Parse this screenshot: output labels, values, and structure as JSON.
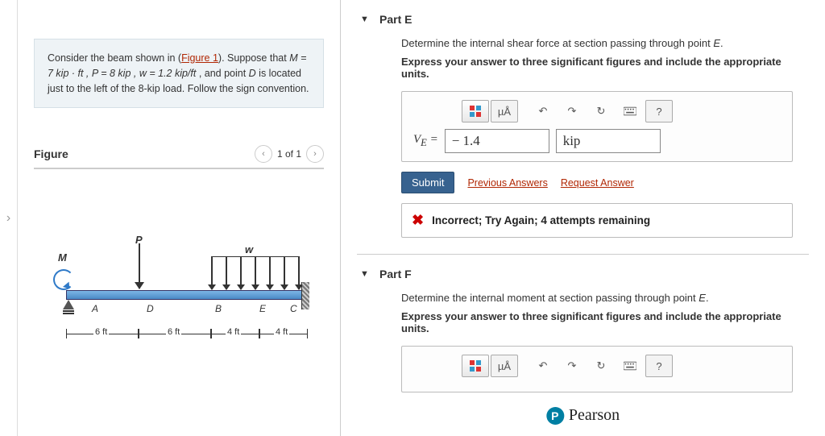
{
  "problem": {
    "intro_a": "Consider the beam shown in (",
    "figure_link": "Figure 1",
    "intro_b": "). Suppose that ",
    "mpf": "M = 7  kip · ft , P = 8  kip , w = 1.2  kip/ft",
    "intro_c": " , and point ",
    "dital": "D",
    "intro_d": " is located just to the left of the 8-kip load. Follow the sign convention."
  },
  "figure": {
    "title": "Figure",
    "pager": "1 of 1",
    "labels": {
      "P": "P",
      "M": "M",
      "w": "w",
      "A": "A",
      "D": "D",
      "B": "B",
      "E": "E",
      "C": "C",
      "d1": "6 ft",
      "d2": "6 ft",
      "d3": "4 ft",
      "d4": "4 ft"
    }
  },
  "partE": {
    "title": "Part E",
    "instr1_a": "Determine the internal shear force at section passing through point ",
    "instr1_pt": "E",
    "instr1_b": ".",
    "instr2": "Express your answer to three significant figures and include the appropriate units.",
    "var": "V",
    "varsub": "E",
    "eq": " = ",
    "value": "− 1.4",
    "unit": "kip",
    "submit": "Submit",
    "prev": "Previous Answers",
    "req": "Request Answer",
    "feedback": "Incorrect; Try Again; 4 attempts remaining",
    "muA": "µÅ",
    "help": "?"
  },
  "partF": {
    "title": "Part F",
    "instr1_a": "Determine the internal moment at section passing through point ",
    "instr1_pt": "E",
    "instr1_b": ".",
    "instr2": "Express your answer to three significant figures and include the appropriate units.",
    "muA": "µÅ",
    "help": "?"
  },
  "brand": "Pearson"
}
